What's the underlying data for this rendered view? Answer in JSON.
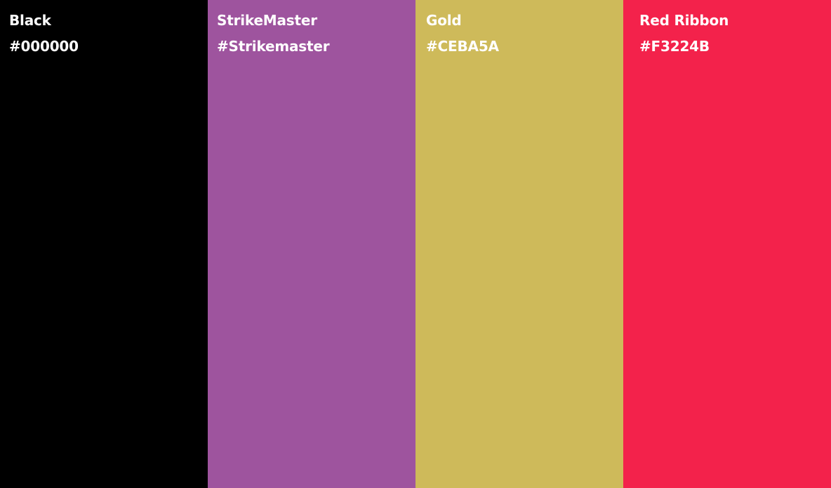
{
  "swatches": [
    {
      "name": "Black",
      "hex_label": "#000000",
      "color": "#000000"
    },
    {
      "name": "StrikeMaster",
      "hex_label": "#Strikemaster",
      "color": "#9E549E"
    },
    {
      "name": "Gold",
      "hex_label": "#CEBA5A",
      "color": "#CEBA5A"
    },
    {
      "name": "Red Ribbon",
      "hex_label": "#F3224B",
      "color": "#F3224B"
    }
  ]
}
